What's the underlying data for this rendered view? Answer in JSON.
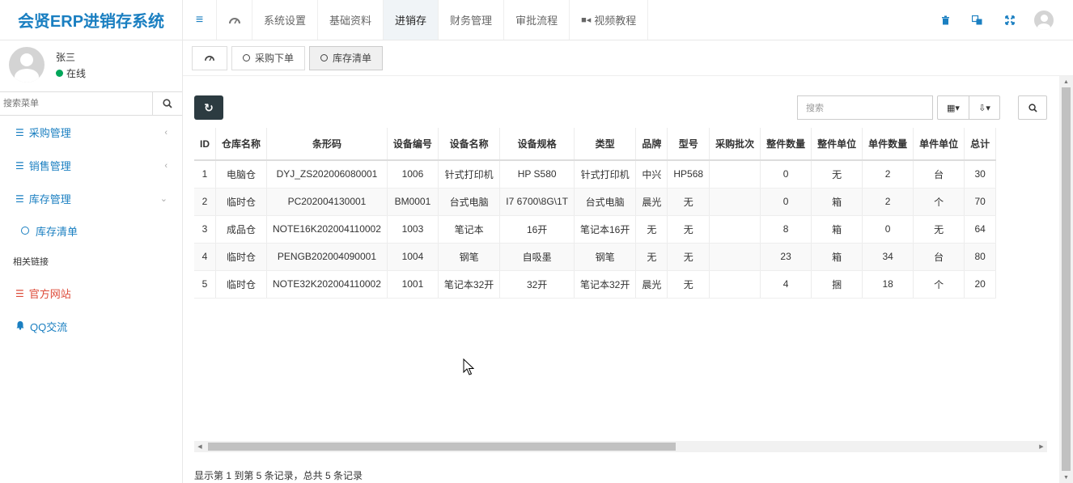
{
  "app": {
    "title": "会贤ERP进销存系统"
  },
  "user": {
    "name": "张三",
    "status": "在线"
  },
  "sidebar": {
    "search_placeholder": "搜索菜单",
    "items": [
      {
        "label": "采购管理",
        "icon": "list-icon",
        "expanded": false
      },
      {
        "label": "销售管理",
        "icon": "list-icon",
        "expanded": false
      },
      {
        "label": "库存管理",
        "icon": "list-icon",
        "expanded": true
      }
    ],
    "sub_items": [
      {
        "label": "库存清单"
      }
    ],
    "links_header": "相关链接",
    "links": [
      {
        "label": "官方网站",
        "icon": "list-icon",
        "color": "#dd4b39"
      },
      {
        "label": "QQ交流",
        "icon": "bell-icon",
        "color": "#1a7fc1"
      }
    ]
  },
  "topnav": {
    "items": [
      "系统设置",
      "基础资料",
      "进销存",
      "财务管理",
      "审批流程",
      "视频教程"
    ],
    "active": "进销存"
  },
  "tabs": [
    "采购下单",
    "库存清单"
  ],
  "active_tab": "库存清单",
  "toolbar": {
    "search_placeholder": "搜索"
  },
  "table": {
    "columns": [
      "ID",
      "仓库名称",
      "条形码",
      "设备编号",
      "设备名称",
      "设备规格",
      "类型",
      "品牌",
      "型号",
      "采购批次",
      "整件数量",
      "整件单位",
      "单件数量",
      "单件单位",
      "总计"
    ],
    "rows": [
      [
        "1",
        "电脑仓",
        "DYJ_ZS202006080001",
        "1006",
        "针式打印机",
        "HP S580",
        "针式打印机",
        "中兴",
        "HP568",
        "",
        "0",
        "无",
        "2",
        "台",
        "30"
      ],
      [
        "2",
        "临时仓",
        "PC202004130001",
        "BM0001",
        "台式电脑",
        "I7 6700\\8G\\1T",
        "台式电脑",
        "晨光",
        "无",
        "",
        "0",
        "箱",
        "2",
        "个",
        "70"
      ],
      [
        "3",
        "成品仓",
        "NOTE16K202004110002",
        "1003",
        "笔记本",
        "16开",
        "笔记本16开",
        "无",
        "无",
        "",
        "8",
        "箱",
        "0",
        "无",
        "64"
      ],
      [
        "4",
        "临时仓",
        "PENGB202004090001",
        "1004",
        "钢笔",
        "自吸墨",
        "钢笔",
        "无",
        "无",
        "",
        "23",
        "箱",
        "34",
        "台",
        "80"
      ],
      [
        "5",
        "临时仓",
        "NOTE32K202004110002",
        "1001",
        "笔记本32开",
        "32开",
        "笔记本32开",
        "晨光",
        "无",
        "",
        "4",
        "捆",
        "18",
        "个",
        "20"
      ]
    ]
  },
  "pager": {
    "info": "显示第 1 到第 5 条记录，总共 5 条记录"
  },
  "colors": {
    "brand": "#1a7fc1",
    "dark_button": "#2c3b41",
    "online": "#00a65a",
    "danger": "#dd4b39"
  }
}
